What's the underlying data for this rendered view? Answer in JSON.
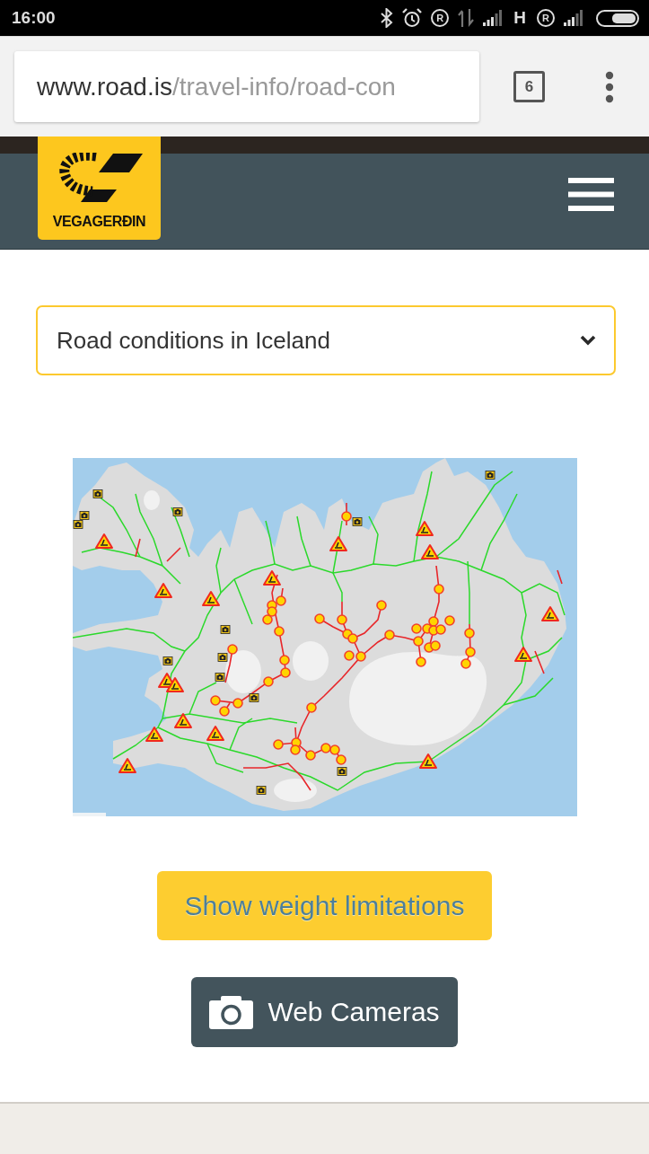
{
  "status_bar": {
    "time": "16:00",
    "roaming": [
      "R",
      "R"
    ],
    "network": "H"
  },
  "browser": {
    "url_host": "www.road.is",
    "url_path": "/travel-info/road-con",
    "tab_count": "6"
  },
  "site_header": {
    "logo_text": "VEGAGERÐIN"
  },
  "region_select": {
    "value": "Road conditions in Iceland"
  },
  "buttons": [
    {
      "kind": "primary",
      "label": "Show weight limitations"
    },
    {
      "kind": "camera",
      "label": "Web Cameras"
    }
  ]
}
